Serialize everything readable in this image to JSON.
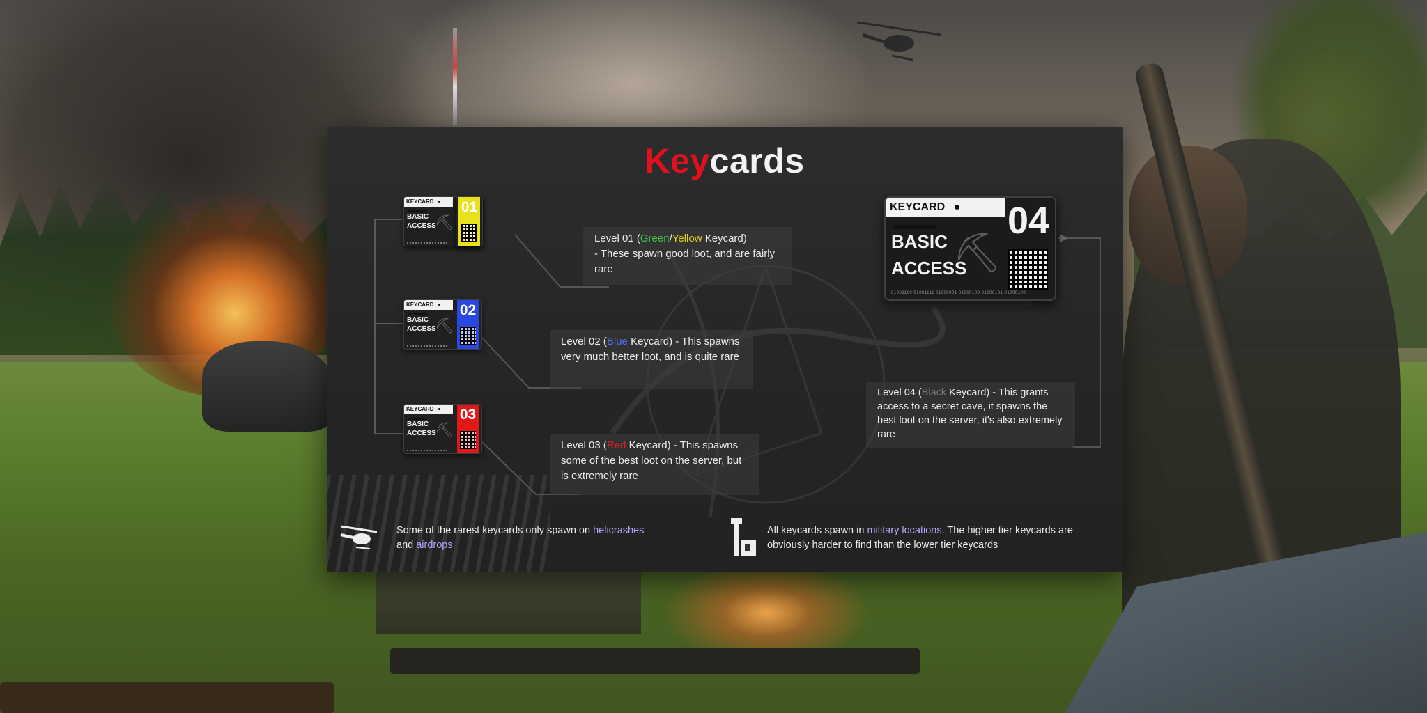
{
  "title": {
    "part_red": "Key",
    "part_white": "cards"
  },
  "keycard_small": {
    "header": "KEYCARD",
    "line1": "BASIC",
    "line2": "ACCESS"
  },
  "keycard_big": {
    "header": "KEYCARD",
    "number": "04",
    "line1": "BASIC",
    "line2": "ACCESS",
    "serial": "01001100 01001111 01000001 01000100 01000101 01000100"
  },
  "cards": [
    {
      "number": "01",
      "colour": "#2fc72f"
    },
    {
      "number": "01",
      "colour": "#e9e11c"
    },
    {
      "number": "02",
      "colour": "#2a48e0"
    },
    {
      "number": "03",
      "colour": "#e01818"
    }
  ],
  "levels": {
    "l1": {
      "pre": "Level 01 (",
      "green": "Green",
      "slash": "/",
      "yellow": "Yellow",
      "post": " Keycard)",
      "rest": "- These spawn good loot, and are fairly rare"
    },
    "l2": {
      "pre": "Level 02 (",
      "colour": "Blue",
      "post": " Keycard) - This spawns very much better loot, and is quite rare"
    },
    "l3": {
      "pre": "Level 03 (",
      "colour": "Red",
      "post": " Keycard) - This spawns some of the best loot on the server, but is extremely rare"
    },
    "l4": {
      "pre": "Level 04 (",
      "colour": "Black",
      "post": " Keycard) - This grants access to a secret cave, it spawns the best loot on the server, it's also extremely rare"
    }
  },
  "footer": {
    "left": {
      "pre": "Some of the rarest keycards only spawn on ",
      "hl1": "helicrashes",
      "mid": " and ",
      "hl2": "airdrops"
    },
    "right": {
      "pre": "All keycards spawn in ",
      "hl": "military locations",
      "post": ". The higher tier keycards are obviously harder to find than the lower tier keycards"
    }
  },
  "colors": {
    "accent_red": "#e0111e",
    "highlight": "#b6a6ff"
  },
  "icons": {
    "helicopter": "helicopter-icon",
    "tower": "military-tower-icon",
    "axe": "axe-icon"
  }
}
